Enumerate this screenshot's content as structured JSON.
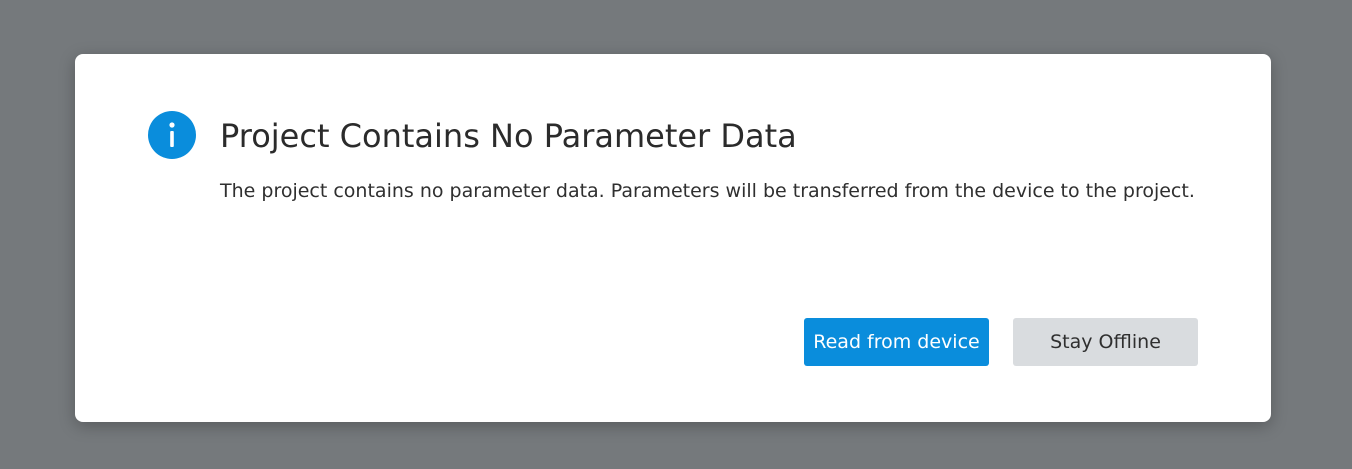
{
  "dialog": {
    "title": "Project Contains No Parameter Data",
    "message": "The project contains no parameter data. Parameters will be transferred from the device to the project.",
    "icon": "info-icon",
    "buttons": {
      "primary_label": "Read from device",
      "secondary_label": "Stay Offline"
    }
  },
  "colors": {
    "backdrop": "#75797c",
    "accent": "#0a8ddc",
    "secondary_button": "#d9dcdf"
  }
}
